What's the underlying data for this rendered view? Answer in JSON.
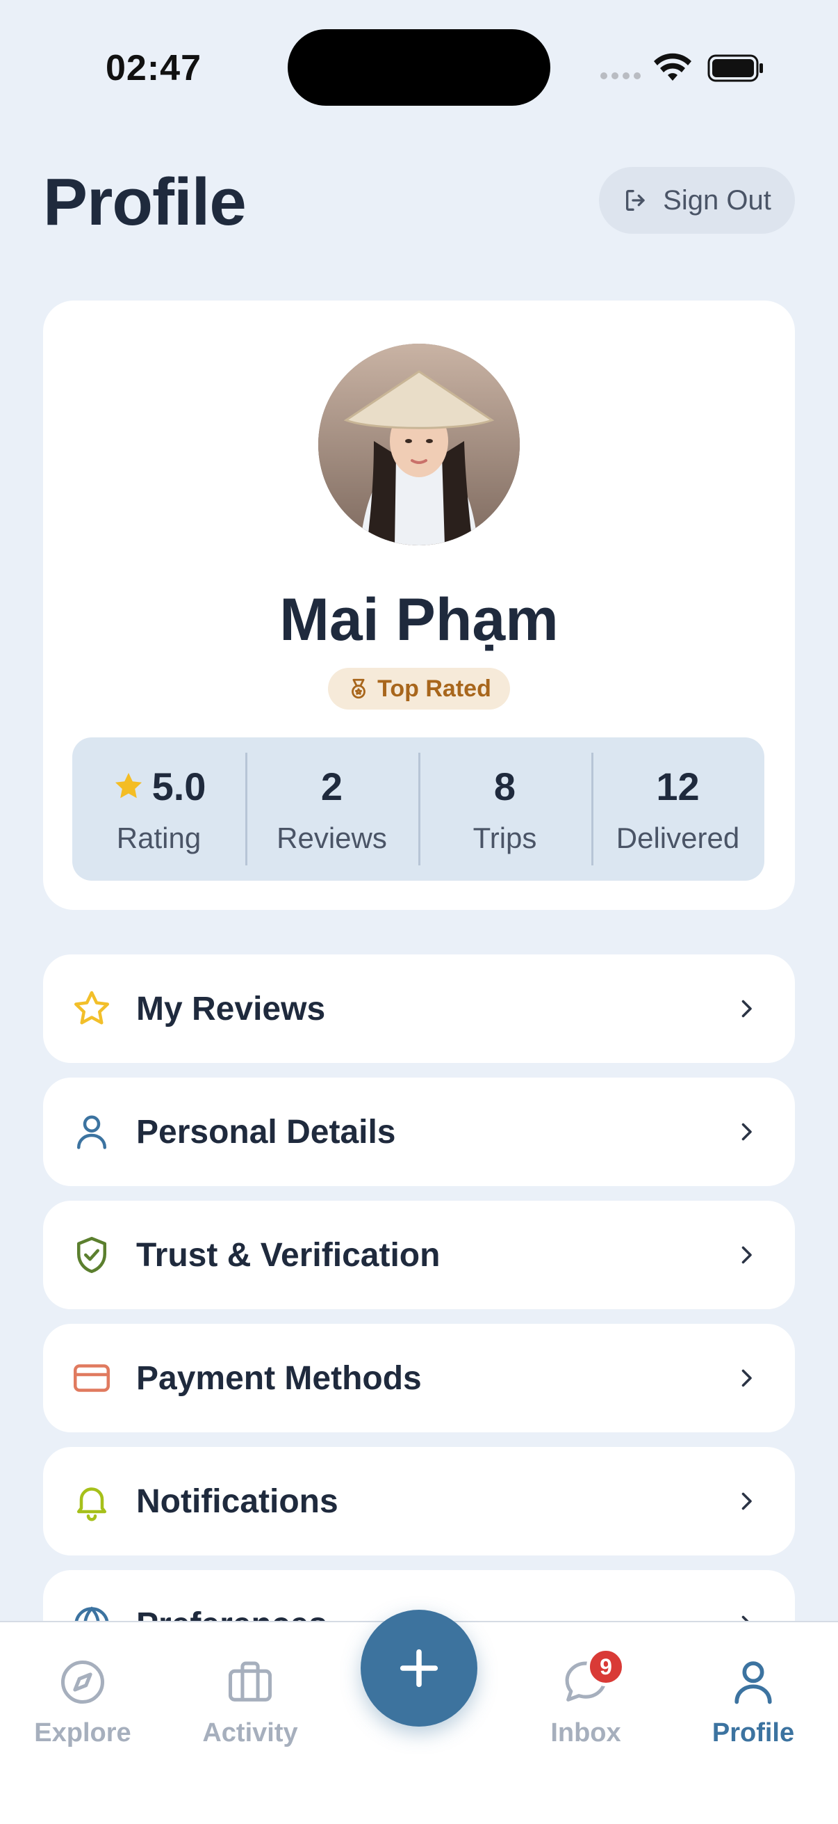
{
  "status_bar": {
    "time": "02:47"
  },
  "header": {
    "title": "Profile",
    "sign_out_label": "Sign Out"
  },
  "profile": {
    "name": "Mai Phạm",
    "badge": "Top Rated",
    "stats": [
      {
        "value": "5.0",
        "label": "Rating",
        "icon": "star-icon"
      },
      {
        "value": "2",
        "label": "Reviews"
      },
      {
        "value": "8",
        "label": "Trips"
      },
      {
        "value": "12",
        "label": "Delivered"
      }
    ]
  },
  "menu": [
    {
      "label": "My Reviews",
      "icon": "star-outline-icon",
      "color": "#f2bf2a"
    },
    {
      "label": "Personal Details",
      "icon": "person-icon",
      "color": "#3c73a0"
    },
    {
      "label": "Trust & Verification",
      "icon": "shield-check-icon",
      "color": "#5b7f2e"
    },
    {
      "label": "Payment Methods",
      "icon": "credit-card-icon",
      "color": "#e07a5f"
    },
    {
      "label": "Notifications",
      "icon": "bell-icon",
      "color": "#a6c01a"
    },
    {
      "label": "Preferences",
      "icon": "globe-icon",
      "color": "#3c73a0"
    }
  ],
  "tab_bar": {
    "tabs": [
      {
        "label": "Explore",
        "icon": "compass-icon"
      },
      {
        "label": "Activity",
        "icon": "briefcase-icon"
      },
      {
        "label": "Inbox",
        "icon": "chat-bubble-icon",
        "badge": "9"
      },
      {
        "label": "Profile",
        "icon": "person-icon",
        "active": true
      }
    ]
  },
  "colors": {
    "background": "#eaf0f8",
    "accent": "#3d739e",
    "text": "#1f2a3d",
    "badge_bg": "#f6ead9",
    "badge_text": "#a8661c",
    "notification_badge": "#d93a36"
  }
}
